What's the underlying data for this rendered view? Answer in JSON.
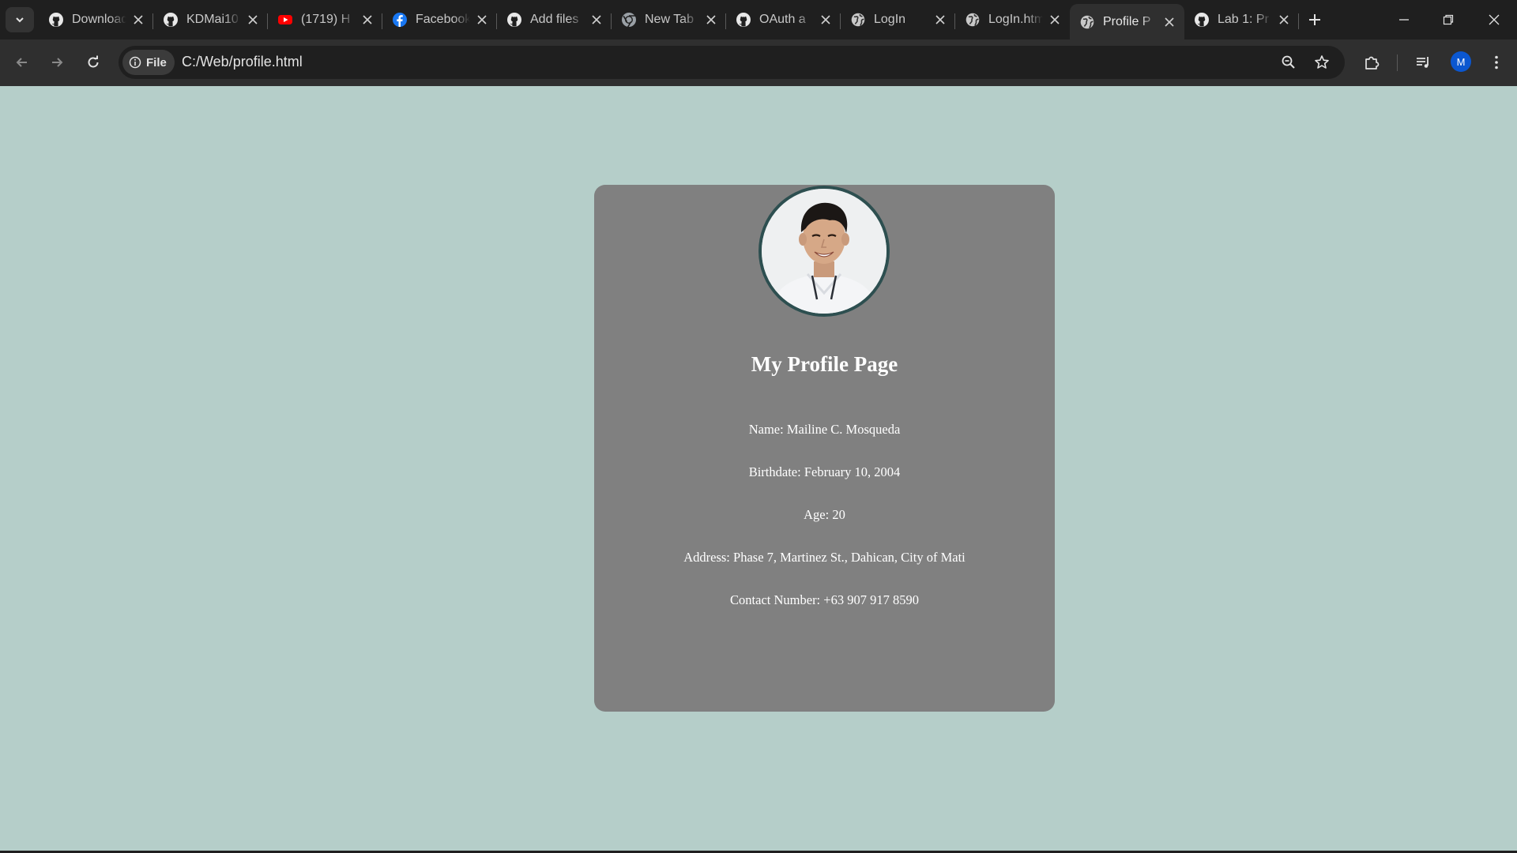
{
  "browser": {
    "tabs": [
      {
        "title": "Download",
        "icon": "github-icon",
        "active": false
      },
      {
        "title": "KDMai10",
        "icon": "github-icon",
        "active": false
      },
      {
        "title": "(1719) H",
        "icon": "youtube-icon",
        "active": false
      },
      {
        "title": "Facebook",
        "icon": "facebook-icon",
        "active": false
      },
      {
        "title": "Add files",
        "icon": "github-icon",
        "active": false
      },
      {
        "title": "New Tab",
        "icon": "chrome-icon",
        "active": false
      },
      {
        "title": "OAuth a",
        "icon": "github-icon",
        "active": false
      },
      {
        "title": "LogIn",
        "icon": "globe-icon",
        "active": false
      },
      {
        "title": "LogIn.htm",
        "icon": "globe-icon",
        "active": false
      },
      {
        "title": "Profile P",
        "icon": "globe-icon",
        "active": true
      },
      {
        "title": "Lab 1: Pr",
        "icon": "github-icon",
        "active": false
      }
    ],
    "address": {
      "chip_label": "File",
      "url": "C:/Web/profile.html"
    },
    "profile_initial": "M"
  },
  "page": {
    "title": "My Profile Page",
    "name_line": "Name: Mailine C. Mosqueda",
    "birthdate_line": "Birthdate: February 10, 2004",
    "age_line": "Age: 20",
    "address_line": "Address: Phase 7, Martinez St., Dahican, City of Mati",
    "contact_line": "Contact Number: +63 907 917 8590"
  },
  "colors": {
    "page_background": "#b5cec9",
    "card_background": "#808080",
    "photo_border": "#2d4f50",
    "text": "#ffffff",
    "chrome_dark": "#1f1f1f",
    "chrome_toolbar": "#2f2f2f",
    "avatar": "#0b57d0"
  }
}
